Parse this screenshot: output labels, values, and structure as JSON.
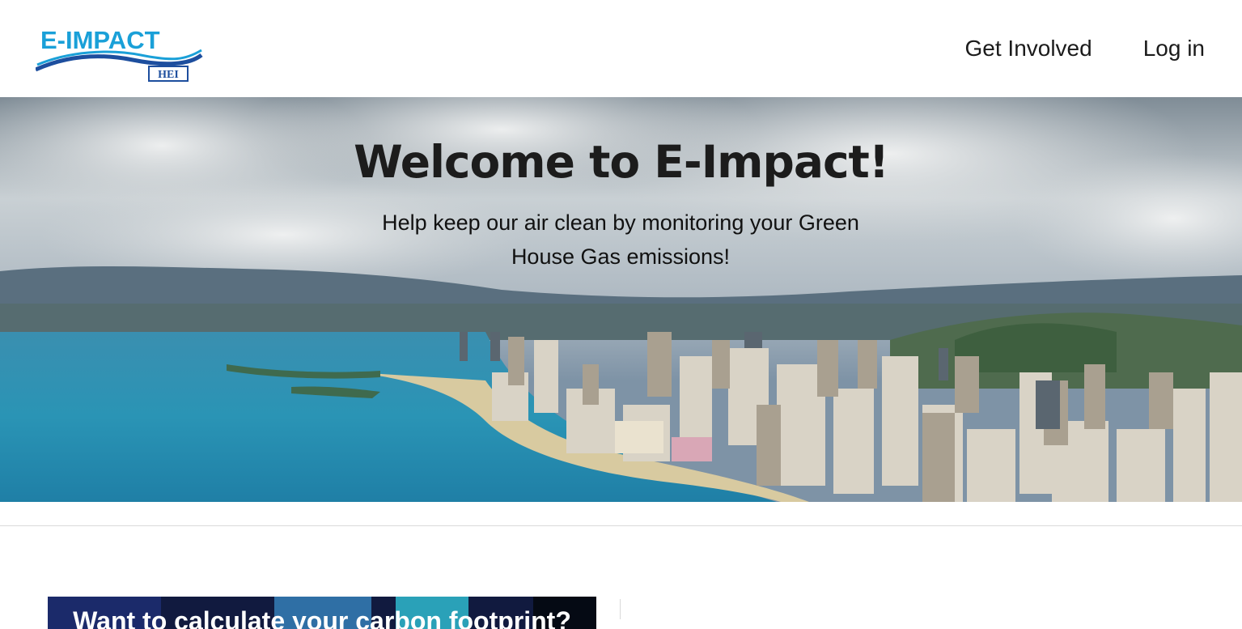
{
  "brand": {
    "logo_wordmark": "E-IMPACT",
    "logo_badge": "HEI",
    "logo_color": "#1aa0d8",
    "logo_wave_color": "#1d4e9e"
  },
  "nav": {
    "items": [
      {
        "label": "Get Involved"
      },
      {
        "label": "Log in"
      }
    ]
  },
  "hero": {
    "title": "Welcome to E-Impact!",
    "subtitle": "Help keep our air clean by monitoring your Green House Gas emissions!",
    "image": "honolulu-waikiki-skyline"
  },
  "card": {
    "title": "Want to calculate your carbon footprint?"
  }
}
